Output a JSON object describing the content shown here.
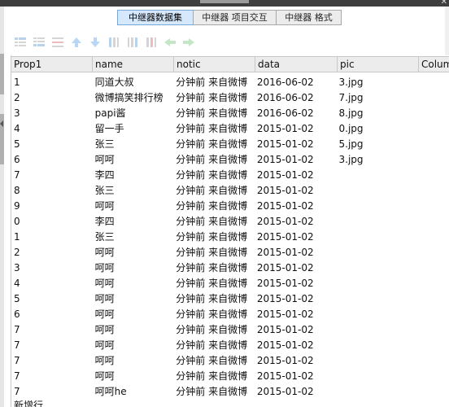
{
  "tabs": [
    {
      "label": "中继器数据集",
      "active": true
    },
    {
      "label": "中继器 项目交互",
      "active": false
    },
    {
      "label": "中继器 格式",
      "active": false
    }
  ],
  "toolbar": {
    "icons": [
      "add-row-above-icon",
      "add-row-below-icon",
      "delete-row-icon",
      "move-up-icon",
      "move-down-icon",
      "add-column-left-icon",
      "add-column-right-icon",
      "delete-column-icon",
      "move-left-icon",
      "move-right-icon"
    ]
  },
  "table": {
    "columns": [
      "Prop1",
      "name",
      "notic",
      "data",
      "pic",
      "Colum"
    ],
    "rows": [
      {
        "prop1": "1",
        "name": "同道大叔",
        "notic": "分钟前  来自微博",
        "data": "2016-06-02",
        "pic": "3.jpg",
        "has_image": true
      },
      {
        "prop1": "2",
        "name": "微博搞笑排行榜",
        "notic": "分钟前  来自微博",
        "data": "2016-06-02",
        "pic": "7.jpg",
        "has_image": true
      },
      {
        "prop1": "3",
        "name": "papi酱",
        "notic": "分钟前  来自微博",
        "data": "2016-06-02",
        "pic": "8.jpg",
        "has_image": true
      },
      {
        "prop1": "4",
        "name": "留一手",
        "notic": "分钟前  来自微博",
        "data": "2015-01-02",
        "pic": "0.jpg",
        "has_image": true
      },
      {
        "prop1": "5",
        "name": "张三",
        "notic": "分钟前  来自微博",
        "data": "2015-01-02",
        "pic": "5.jpg",
        "has_image": true
      },
      {
        "prop1": "6",
        "name": "呵呵",
        "notic": "分钟前  来自微博",
        "data": "2015-01-02",
        "pic": "3.jpg",
        "has_image": true
      },
      {
        "prop1": "7",
        "name": "李四",
        "notic": "分钟前  来自微博",
        "data": "2015-01-02",
        "pic": "",
        "has_image": false
      },
      {
        "prop1": "8",
        "name": "张三",
        "notic": "分钟前  来自微博",
        "data": "2015-01-02",
        "pic": "",
        "has_image": false
      },
      {
        "prop1": "9",
        "name": "呵呵",
        "notic": "分钟前  来自微博",
        "data": "2015-01-02",
        "pic": "",
        "has_image": false
      },
      {
        "prop1": "0",
        "name": "李四",
        "notic": "分钟前  来自微博",
        "data": "2015-01-02",
        "pic": "",
        "has_image": false
      },
      {
        "prop1": "1",
        "name": "张三",
        "notic": "分钟前  来自微博",
        "data": "2015-01-02",
        "pic": "",
        "has_image": false
      },
      {
        "prop1": "2",
        "name": "呵呵",
        "notic": "分钟前  来自微博",
        "data": "2015-01-02",
        "pic": "",
        "has_image": false
      },
      {
        "prop1": "3",
        "name": "呵呵",
        "notic": "分钟前  来自微博",
        "data": "2015-01-02",
        "pic": "",
        "has_image": false
      },
      {
        "prop1": "4",
        "name": "呵呵",
        "notic": "分钟前  来自微博",
        "data": "2015-01-02",
        "pic": "",
        "has_image": false
      },
      {
        "prop1": "5",
        "name": "呵呵",
        "notic": "分钟前  来自微博",
        "data": "2015-01-02",
        "pic": "",
        "has_image": false
      },
      {
        "prop1": "6",
        "name": "呵呵",
        "notic": "分钟前  来自微博",
        "data": "2015-01-02",
        "pic": "",
        "has_image": false
      },
      {
        "prop1": "7",
        "name": "呵呵",
        "notic": "分钟前  来自微博",
        "data": "2015-01-02",
        "pic": "",
        "has_image": false
      },
      {
        "prop1": "7",
        "name": "呵呵",
        "notic": "分钟前  来自微博",
        "data": "2015-01-02",
        "pic": "",
        "has_image": false
      },
      {
        "prop1": "7",
        "name": "呵呵",
        "notic": "分钟前  来自微博",
        "data": "2015-01-02",
        "pic": "",
        "has_image": false
      },
      {
        "prop1": "7",
        "name": "呵呵",
        "notic": "分钟前  来自微博",
        "data": "2015-01-02",
        "pic": "",
        "has_image": false
      },
      {
        "prop1": "7",
        "name": "呵呵he",
        "notic": "分钟前  来自微博",
        "data": "2015-01-02",
        "pic": "",
        "has_image": false
      }
    ],
    "new_row_label": "新增行"
  }
}
